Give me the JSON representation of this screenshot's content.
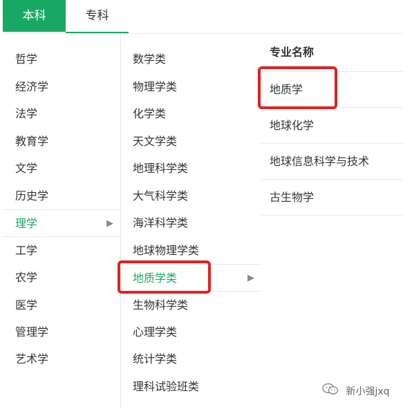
{
  "tabs": [
    {
      "label": "本科",
      "active": true
    },
    {
      "label": "专科",
      "active": false
    }
  ],
  "categories": [
    {
      "label": "哲学"
    },
    {
      "label": "经济学"
    },
    {
      "label": "法学"
    },
    {
      "label": "教育学"
    },
    {
      "label": "文学"
    },
    {
      "label": "历史学"
    },
    {
      "label": "理学",
      "selected": true
    },
    {
      "label": "工学"
    },
    {
      "label": "农学"
    },
    {
      "label": "医学"
    },
    {
      "label": "管理学"
    },
    {
      "label": "艺术学"
    }
  ],
  "subcategories": [
    {
      "label": "数学类"
    },
    {
      "label": "物理学类"
    },
    {
      "label": "化学类"
    },
    {
      "label": "天文学类"
    },
    {
      "label": "地理科学类"
    },
    {
      "label": "大气科学类"
    },
    {
      "label": "海洋科学类"
    },
    {
      "label": "地球物理学类"
    },
    {
      "label": "地质学类",
      "selected": true
    },
    {
      "label": "生物科学类"
    },
    {
      "label": "心理学类"
    },
    {
      "label": "统计学类"
    },
    {
      "label": "理科试验班类"
    }
  ],
  "majors": {
    "header": "专业名称",
    "items": [
      "地质学",
      "地球化学",
      "地球信息科学与技术",
      "古生物学"
    ]
  },
  "watermark": "新小强jxq",
  "colors": {
    "accent": "#18a866",
    "highlight": "#e02020"
  },
  "icons": {
    "expand": "arrow-right-icon",
    "watermark": "wechat-icon"
  }
}
